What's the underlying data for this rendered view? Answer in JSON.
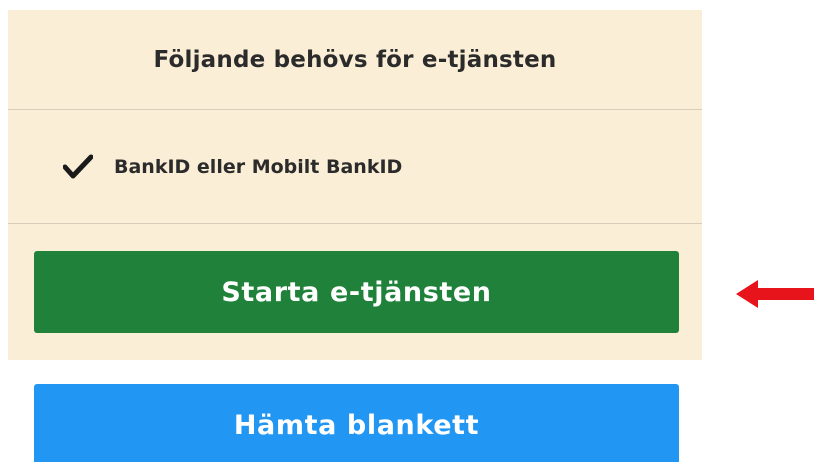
{
  "panel": {
    "title": "Följande behövs för e-tjänsten",
    "requirements": [
      {
        "label": "BankID eller Mobilt BankID",
        "icon": "checkmark-icon"
      }
    ]
  },
  "buttons": {
    "start_label": "Starta e-tjänsten",
    "fetch_label": "Hämta blankett"
  },
  "annotation": {
    "icon": "red-arrow-left-icon",
    "color": "#e8141c"
  },
  "colors": {
    "panel_bg": "#fbeed6",
    "start_button": "#20813b",
    "fetch_button": "#2196f3"
  }
}
